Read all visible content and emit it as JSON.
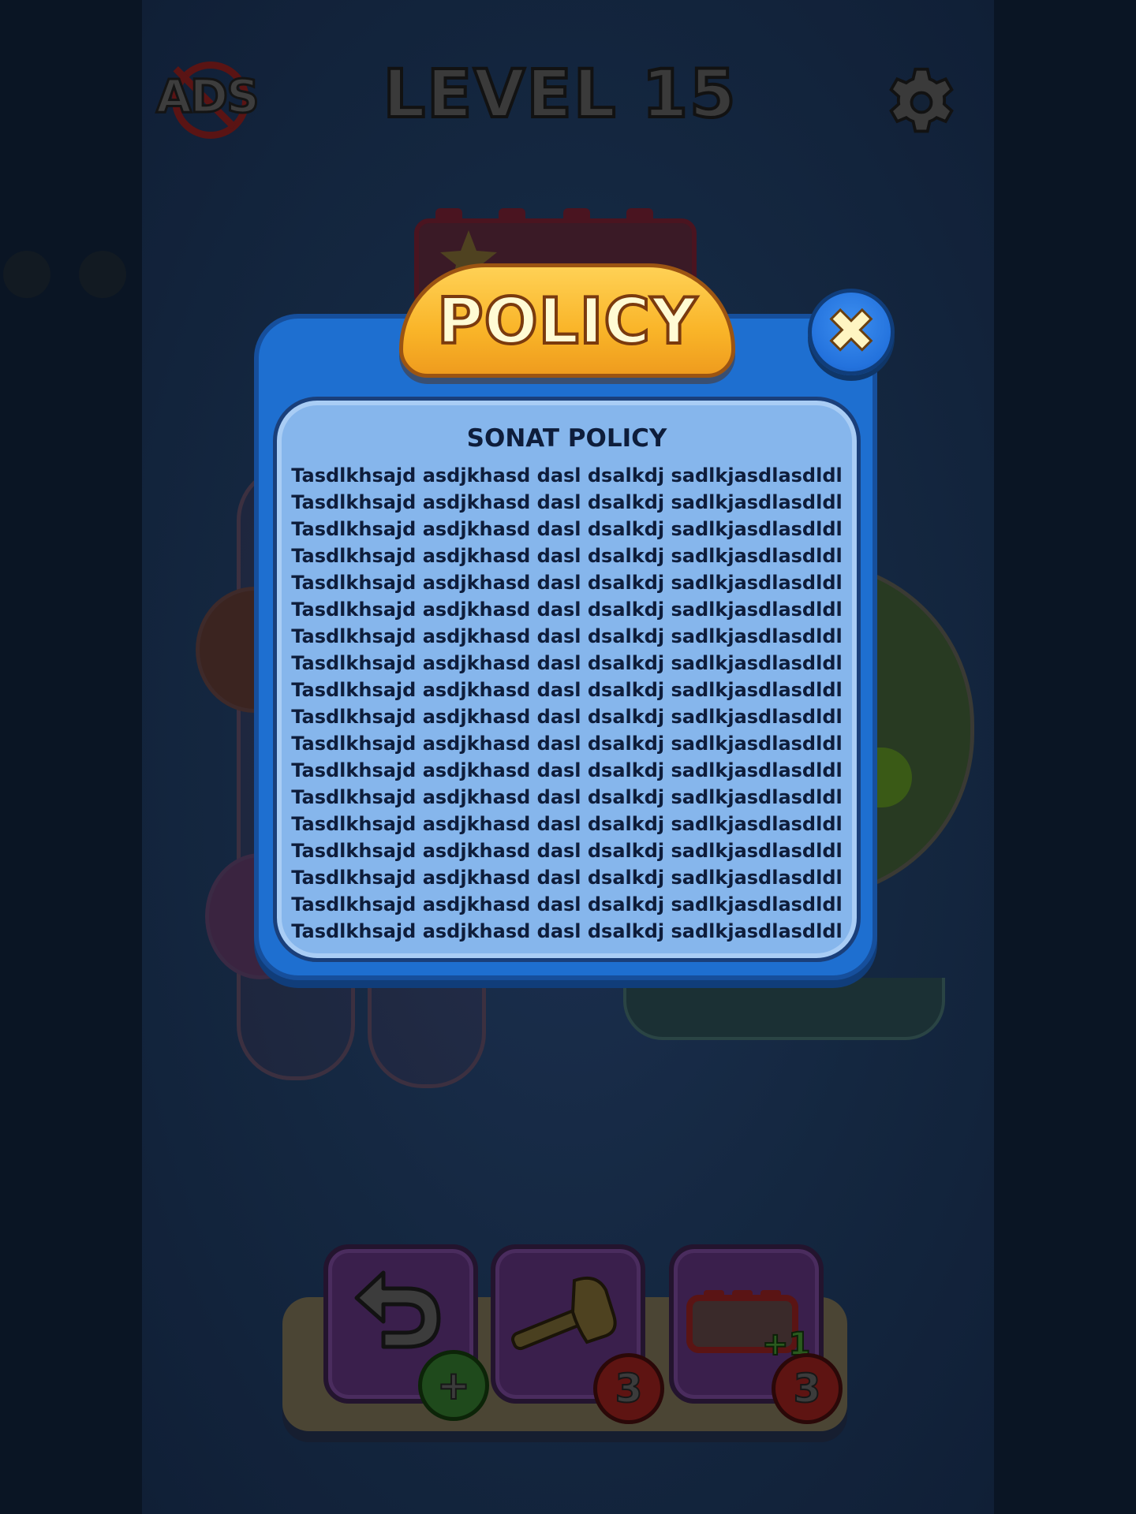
{
  "header": {
    "ads_label": "ADS",
    "level_title": "LEVEL 15"
  },
  "dialog": {
    "title": "POLICY",
    "close_symbol": "✖",
    "heading": "SONAT POLICY",
    "lines": [
      "Tasdlkhsajd asdjkhasd dasl dsalkdj sadlkjasdlasdldl",
      "Tasdlkhsajd asdjkhasd dasl dsalkdj sadlkjasdlasdldl",
      "Tasdlkhsajd asdjkhasd dasl dsalkdj sadlkjasdlasdldl",
      "Tasdlkhsajd asdjkhasd dasl dsalkdj sadlkjasdlasdldl",
      "Tasdlkhsajd asdjkhasd dasl dsalkdj sadlkjasdlasdldl",
      "Tasdlkhsajd asdjkhasd dasl dsalkdj sadlkjasdlasdldl",
      "Tasdlkhsajd asdjkhasd dasl dsalkdj sadlkjasdlasdldl",
      "Tasdlkhsajd asdjkhasd dasl dsalkdj sadlkjasdlasdldl",
      "Tasdlkhsajd asdjkhasd dasl dsalkdj sadlkjasdlasdldl",
      "Tasdlkhsajd asdjkhasd dasl dsalkdj sadlkjasdlasdldl",
      "Tasdlkhsajd asdjkhasd dasl dsalkdj sadlkjasdlasdldl",
      "Tasdlkhsajd asdjkhasd dasl dsalkdj sadlkjasdlasdldl",
      "Tasdlkhsajd asdjkhasd dasl dsalkdj sadlkjasdlasdldl",
      "Tasdlkhsajd asdjkhasd dasl dsalkdj sadlkjasdlasdldl",
      "Tasdlkhsajd asdjkhasd dasl dsalkdj sadlkjasdlasdldl",
      "Tasdlkhsajd asdjkhasd dasl dsalkdj sadlkjasdlasdldl",
      "Tasdlkhsajd asdjkhasd dasl dsalkdj sadlkjasdlasdldl",
      "Tasdlkhsajd asdjkhasd dasl dsalkdj sadlkjasdlasdldl"
    ]
  },
  "toolbar": {
    "undo": {
      "icon": "undo-arrow-icon",
      "badge": "+"
    },
    "hammer": {
      "icon": "hammer-icon",
      "badge": "3"
    },
    "add_slot": {
      "icon": "add-slot-icon",
      "label": "+1",
      "badge": "3"
    }
  },
  "colors": {
    "dialog_blue": "#1e6fd0",
    "panel_blue": "#86b6ec",
    "title_yellow": "#f9b428",
    "text_dark": "#0e1d3b"
  }
}
